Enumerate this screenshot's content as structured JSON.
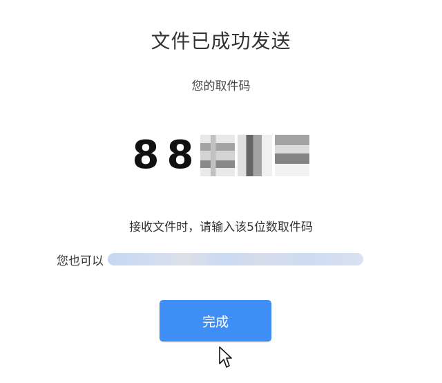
{
  "dialog": {
    "title": "文件已成功发送",
    "subtitle": "您的取件码",
    "code_visible": [
      "8",
      "8"
    ],
    "hint": "接收文件时，请输入该5位数取件码",
    "alt_prefix": "您也可以",
    "done_label": "完成"
  }
}
